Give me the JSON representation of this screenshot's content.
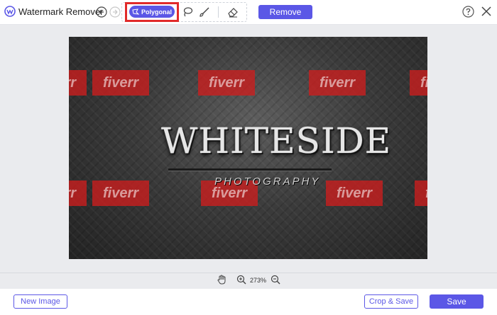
{
  "app": {
    "title": "Watermark Remover",
    "accent": "#5b57e6"
  },
  "toolbar": {
    "undo_icon": "undo-icon",
    "redo_icon": "redo-icon",
    "polygonal_label": "Polygonal",
    "lasso_icon": "lasso-icon",
    "brush_icon": "brush-icon",
    "eraser_icon": "eraser-icon",
    "remove_label": "Remove",
    "help_icon": "help-icon",
    "close_icon": "close-icon",
    "highlight_color": "#e12a2a"
  },
  "image": {
    "watermarks": [
      "fiverr",
      "fiverr",
      "fiverr",
      "fiverr",
      "fiverr",
      "fiverr",
      "fiverr",
      "fiverr",
      "fiverr",
      "fiverr"
    ],
    "logo_title": "WHITESIDE",
    "logo_subtitle": "PHOTOGRAPHY"
  },
  "zoom": {
    "value": "273%"
  },
  "footer": {
    "new_image_label": "New Image",
    "crop_save_label": "Crop & Save",
    "save_label": "Save"
  }
}
